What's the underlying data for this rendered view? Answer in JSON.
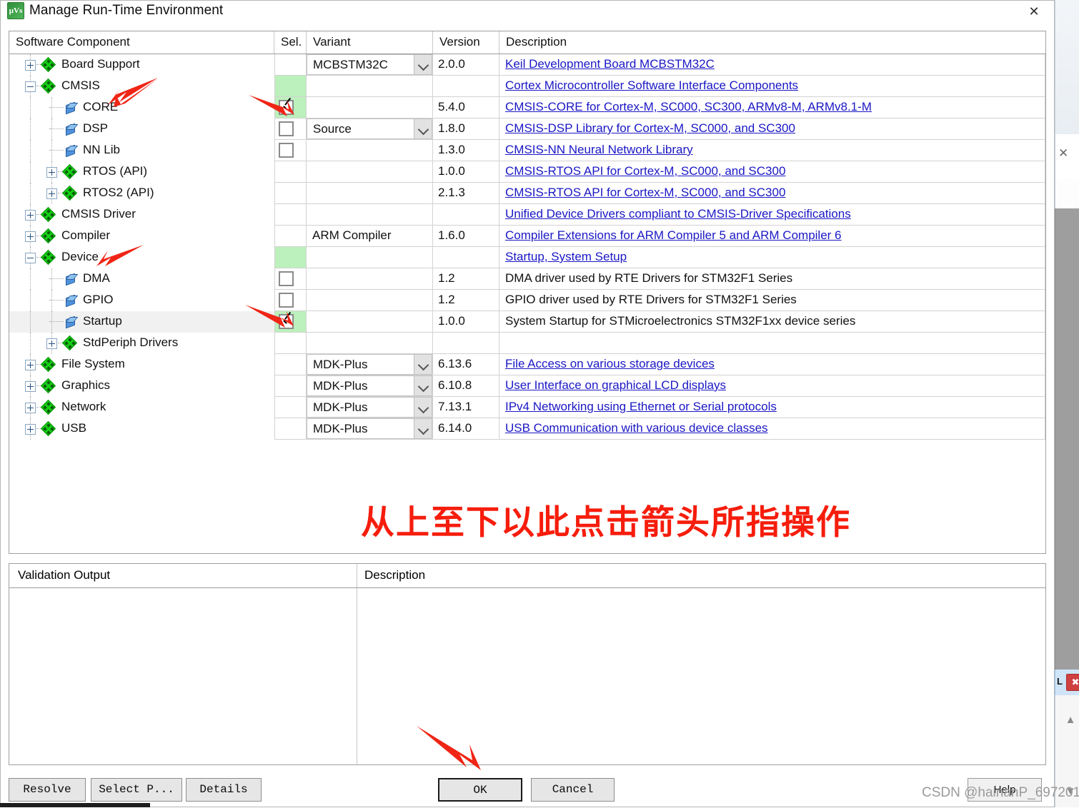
{
  "window": {
    "title": "Manage Run-Time Environment",
    "app_icon_text": "μVs",
    "close_label": "✕"
  },
  "grid": {
    "headers": {
      "name": "Software Component",
      "sel": "Sel.",
      "variant": "Variant",
      "version": "Version",
      "description": "Description"
    },
    "rows": [
      {
        "name": "Board Support",
        "level": 0,
        "node": "expandable-collapsed",
        "icon": "pack-icon",
        "sel": "none",
        "variant": "MCBSTM32C",
        "variant_dropdown": true,
        "version": "2.0.0",
        "description": "Keil Development Board MCBSTM32C",
        "desc_link": true
      },
      {
        "name": "CMSIS",
        "level": 0,
        "node": "expandable-expanded",
        "icon": "pack-icon",
        "sel": "green-empty",
        "variant": "",
        "variant_dropdown": false,
        "version": "",
        "description": "Cortex Microcontroller Software Interface Components",
        "desc_link": true
      },
      {
        "name": "CORE",
        "level": 1,
        "node": "leaf",
        "icon": "component-icon",
        "sel": "green-checked",
        "variant": "",
        "variant_dropdown": false,
        "version": "5.4.0",
        "description": "CMSIS-CORE for Cortex-M, SC000, SC300, ARMv8-M, ARMv8.1-M",
        "desc_link": true
      },
      {
        "name": "DSP",
        "level": 1,
        "node": "leaf",
        "icon": "component-icon",
        "sel": "unchecked",
        "variant": "Source",
        "variant_dropdown": true,
        "version": "1.8.0",
        "description": "CMSIS-DSP Library for Cortex-M, SC000, and SC300",
        "desc_link": true
      },
      {
        "name": "NN Lib",
        "level": 1,
        "node": "leaf",
        "icon": "component-icon",
        "sel": "unchecked",
        "variant": "",
        "variant_dropdown": false,
        "version": "1.3.0",
        "description": "CMSIS-NN Neural Network Library",
        "desc_link": true
      },
      {
        "name": "RTOS (API)",
        "level": 1,
        "node": "expandable-collapsed",
        "icon": "pack-icon",
        "sel": "none",
        "variant": "",
        "variant_dropdown": false,
        "version": "1.0.0",
        "description": "CMSIS-RTOS API for Cortex-M, SC000, and SC300",
        "desc_link": true
      },
      {
        "name": "RTOS2 (API)",
        "level": 1,
        "node": "expandable-collapsed",
        "icon": "pack-icon",
        "sel": "none",
        "variant": "",
        "variant_dropdown": false,
        "version": "2.1.3",
        "description": "CMSIS-RTOS API for Cortex-M, SC000, and SC300",
        "desc_link": true
      },
      {
        "name": "CMSIS Driver",
        "level": 0,
        "node": "expandable-collapsed",
        "icon": "pack-icon",
        "sel": "none",
        "variant": "",
        "variant_dropdown": false,
        "version": "",
        "description": "Unified Device Drivers compliant to CMSIS-Driver Specifications",
        "desc_link": true
      },
      {
        "name": "Compiler",
        "level": 0,
        "node": "expandable-collapsed",
        "icon": "pack-icon",
        "sel": "none",
        "variant": "ARM Compiler",
        "variant_dropdown": false,
        "version": "1.6.0",
        "description": "Compiler Extensions for ARM Compiler 5 and ARM Compiler 6",
        "desc_link": true
      },
      {
        "name": "Device",
        "level": 0,
        "node": "expandable-expanded",
        "icon": "pack-icon",
        "sel": "green-empty",
        "variant": "",
        "variant_dropdown": false,
        "version": "",
        "description": "Startup, System Setup",
        "desc_link": true
      },
      {
        "name": "DMA",
        "level": 1,
        "node": "leaf",
        "icon": "component-icon",
        "sel": "unchecked",
        "variant": "",
        "variant_dropdown": false,
        "version": "1.2",
        "description": "DMA driver used by RTE Drivers for STM32F1 Series",
        "desc_link": false
      },
      {
        "name": "GPIO",
        "level": 1,
        "node": "leaf",
        "icon": "component-icon",
        "sel": "unchecked",
        "variant": "",
        "variant_dropdown": false,
        "version": "1.2",
        "description": "GPIO driver used by RTE Drivers for STM32F1 Series",
        "desc_link": false
      },
      {
        "name": "Startup",
        "level": 1,
        "node": "leaf",
        "icon": "component-icon",
        "highlight": true,
        "sel": "green-checked",
        "variant": "",
        "variant_dropdown": false,
        "version": "1.0.0",
        "description": "System Startup for STMicroelectronics STM32F1xx device series",
        "desc_link": false
      },
      {
        "name": "StdPeriph Drivers",
        "level": 1,
        "node": "expandable-collapsed",
        "icon": "pack-icon",
        "sel": "none",
        "variant": "",
        "variant_dropdown": false,
        "version": "",
        "description": "",
        "desc_link": false
      },
      {
        "name": "File System",
        "level": 0,
        "node": "expandable-collapsed",
        "icon": "pack-icon",
        "sel": "none",
        "variant": "MDK-Plus",
        "variant_dropdown": true,
        "version": "6.13.6",
        "description": "File Access on various storage devices",
        "desc_link": true
      },
      {
        "name": "Graphics",
        "level": 0,
        "node": "expandable-collapsed",
        "icon": "pack-icon",
        "sel": "none",
        "variant": "MDK-Plus",
        "variant_dropdown": true,
        "version": "6.10.8",
        "description": "User Interface on graphical LCD displays",
        "desc_link": true
      },
      {
        "name": "Network",
        "level": 0,
        "node": "expandable-collapsed",
        "icon": "pack-icon",
        "sel": "none",
        "variant": "MDK-Plus",
        "variant_dropdown": true,
        "version": "7.13.1",
        "description": "IPv4 Networking using Ethernet or Serial protocols",
        "desc_link": true
      },
      {
        "name": "USB",
        "level": 0,
        "node": "expandable-collapsed",
        "icon": "pack-icon",
        "sel": "none",
        "variant": "MDK-Plus",
        "variant_dropdown": true,
        "version": "6.14.0",
        "description": "USB Communication with various device classes",
        "desc_link": true
      }
    ]
  },
  "annotation": {
    "note_cn": "从上至下以此点击箭头所指操作",
    "color": "#f61d0c",
    "arrow_count": 4
  },
  "validation": {
    "header_output": "Validation Output",
    "header_description": "Description",
    "rows": []
  },
  "footer": {
    "resolve": "Resolve",
    "select_packs": "Select P...",
    "details": "Details",
    "ok": "OK",
    "cancel": "Cancel",
    "help": "Help"
  },
  "watermark": "CSDN @hainanP_697201",
  "colors": {
    "selected_cell": "#bcf0bc",
    "link": "#1a17c4",
    "annotation_red": "#f61d0c",
    "pack_icon_green": "#14d314",
    "component_icon_blue": "#4f92dc"
  }
}
